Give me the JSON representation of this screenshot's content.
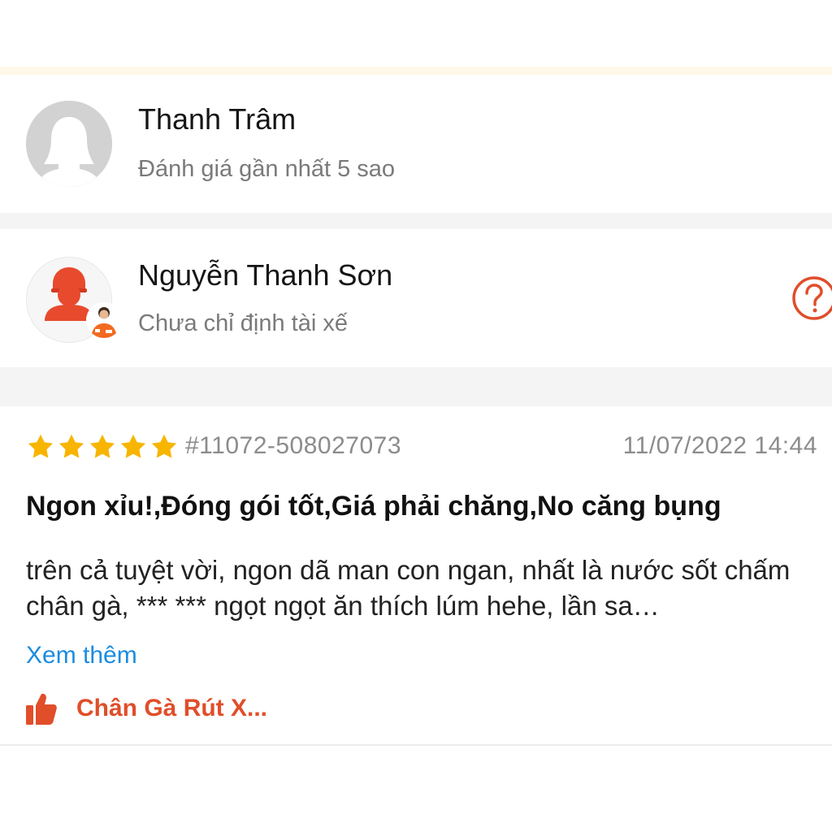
{
  "customer": {
    "name": "Thanh Trâm",
    "subtitle": "Đánh giá gần nhất 5 sao",
    "avatar_icon": "default-user-avatar"
  },
  "driver": {
    "name": "Nguyễn Thanh Sơn",
    "subtitle": "Chưa chỉ định tài xế",
    "avatar_icon": "driver-avatar",
    "help_icon": "question-circle-icon"
  },
  "review": {
    "rating": 5,
    "order_id": "#11072-508027073",
    "date": "11/07/2022 14:44",
    "title": "Ngon xỉu!,Đóng gói tốt,Giá phải chăng,No căng bụng",
    "body": "trên cả tuyệt vời, ngon dã man con ngan, nhất là nước sốt chấm chân gà, *** *** ngọt ngọt ăn thích lúm hehe, lần sa…",
    "see_more_label": "Xem thêm",
    "liked_dish": "Chân Gà Rút X..."
  },
  "colors": {
    "star": "#f7b500",
    "accent": "#e04e2a",
    "link": "#1a8ce0",
    "secondary_text": "#7a7a7a",
    "section_gap": "#f4f4f4"
  }
}
